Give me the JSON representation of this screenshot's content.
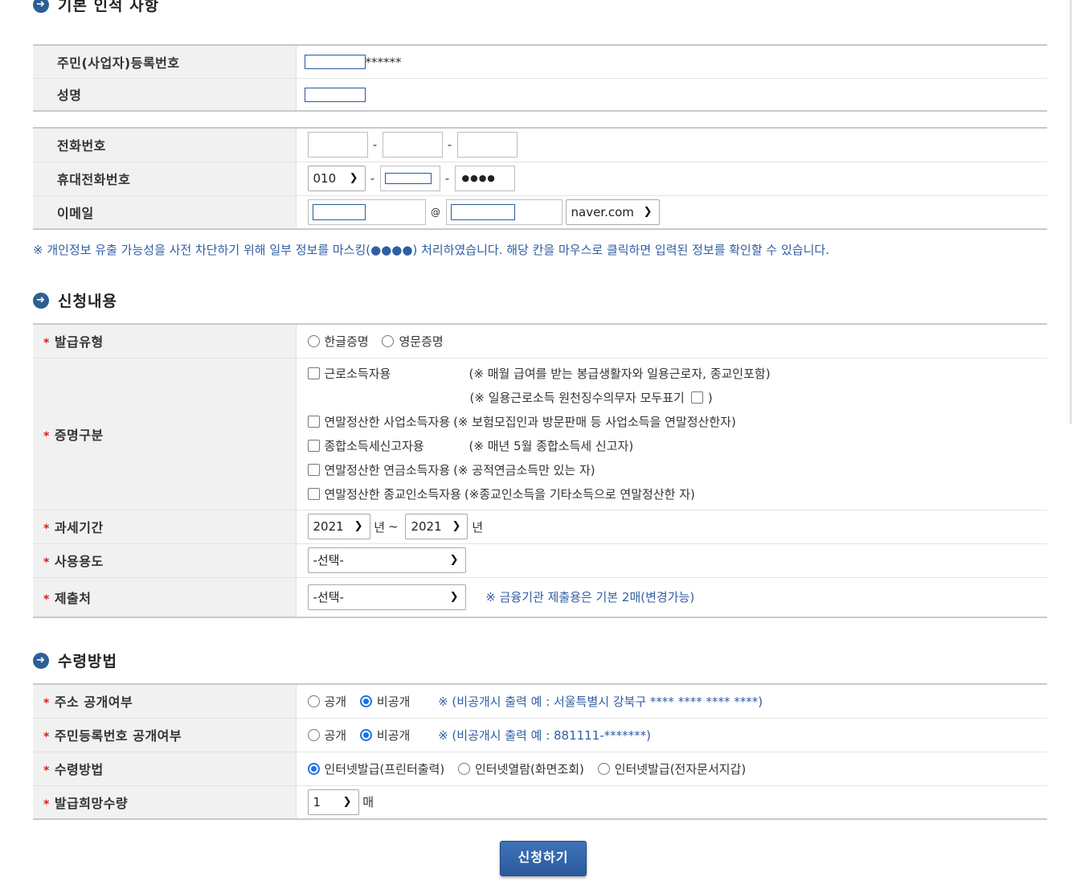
{
  "sections": {
    "basic": "기본 인적 사항",
    "apply": "신청내용",
    "receive": "수령방법"
  },
  "basic": {
    "ssn_label": "주민(사업자)등록번호",
    "ssn_suffix": "******",
    "name_label": "성명",
    "phone_label": "전화번호",
    "mobile_label": "휴대전화번호",
    "mobile_prefix": "010",
    "mobile_last": "●●●●",
    "email_label": "이메일",
    "at": "@",
    "email_domain": "naver.com",
    "privacy_note": "※ 개인정보 유출 가능성을 사전 차단하기 위해 일부 정보를 마스킹(●●●●) 처리하였습니다. 해당 칸을 마우스로 클릭하면 입력된 정보를 확인할 수 있습니다."
  },
  "apply": {
    "type_label": "발급유형",
    "type_options": [
      "한글증명",
      "영문증명"
    ],
    "cert_label": "증명구분",
    "cert_items": [
      {
        "label": "근로소득자용",
        "note": "(※ 매월 급여를 받는 봉급생활자와 일용근로자, 종교인포함)"
      },
      {
        "label": "",
        "note": "(※ 일용근로소득 원천징수의무자 모두표기",
        "note_end": ")"
      },
      {
        "label": "연말정산한 사업소득자용",
        "note": "(※ 보험모집인과 방문판매 등 사업소득을 연말정산한자)"
      },
      {
        "label": "종합소득세신고자용",
        "note": "(※ 매년 5월 종합소득세 신고자)"
      },
      {
        "label": "연말정산한 연금소득자용",
        "note": "(※ 공적연금소득만 있는 자)"
      },
      {
        "label": "연말정산한 종교인소득자용",
        "note": "(※종교인소득을 기타소득으로 연말정산한 자)"
      }
    ],
    "period_label": "과세기간",
    "year_from": "2021",
    "year_to": "2021",
    "year_unit": "년",
    "tilde": "~",
    "usage_label": "사용용도",
    "usage_value": "-선택-",
    "submit_to_label": "제출처",
    "submit_to_value": "-선택-",
    "submit_note": "※ 금융기관 제출용은 기본 2매(변경가능)"
  },
  "receive": {
    "addr_label": "주소 공개여부",
    "ssn_disc_label": "주민등록번호 공개여부",
    "open": "공개",
    "closed": "비공개",
    "addr_note": "※ (비공개시 출력 예 : 서울특별시 강북구 **** **** **** ****)",
    "ssn_note": "※ (비공개시 출력 예 : 881111-*******)",
    "method_label": "수령방법",
    "method_options": [
      "인터넷발급(프린터출력)",
      "인터넷열람(화면조회)",
      "인터넷발급(전자문서지갑)"
    ],
    "qty_label": "발급희망수량",
    "qty_value": "1",
    "qty_unit": "매"
  },
  "submit_button": "신청하기"
}
